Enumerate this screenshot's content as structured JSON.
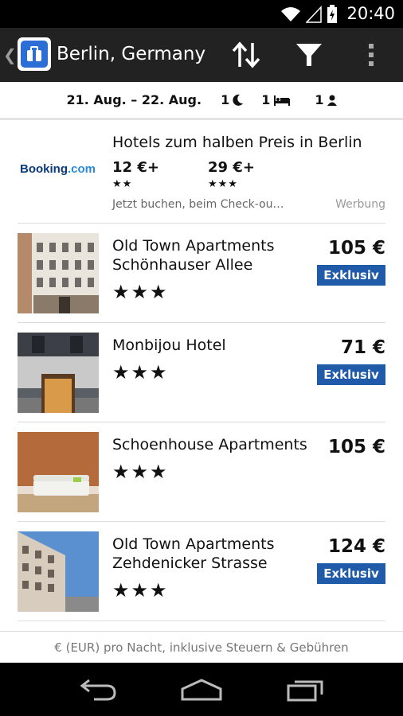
{
  "status": {
    "time": "20:40"
  },
  "header": {
    "title": "Berlin, Germany"
  },
  "datebar": {
    "dates": "21. Aug. – 22. Aug.",
    "nights": "1",
    "rooms": "1",
    "guests": "1"
  },
  "ad": {
    "logo_booking": "Booking",
    "logo_com": ".com",
    "headline": "Hotels zum halben Preis in Berlin",
    "price1": "12 €+",
    "stars1": "★★",
    "price2": "29 €+",
    "stars2": "★★★",
    "sub": "Jetzt buchen, beim Check-ou…",
    "label": "Werbung"
  },
  "hotels": [
    {
      "name": "Old Town Apartments Schönhauser Allee",
      "stars": "★★★",
      "price": "105 €",
      "badge": "Exklusiv"
    },
    {
      "name": "Monbijou Hotel",
      "stars": "★★★",
      "price": "71 €",
      "badge": "Exklusiv"
    },
    {
      "name": "Schoenhouse Apartments",
      "stars": "★★★",
      "price": "105 €",
      "badge": ""
    },
    {
      "name": "Old Town Apartments Zehdenicker Strasse",
      "stars": "★★★",
      "price": "124 €",
      "badge": "Exklusiv"
    }
  ],
  "footer": {
    "note": "€ (EUR) pro Nacht, inklusive Steuern & Gebühren"
  }
}
